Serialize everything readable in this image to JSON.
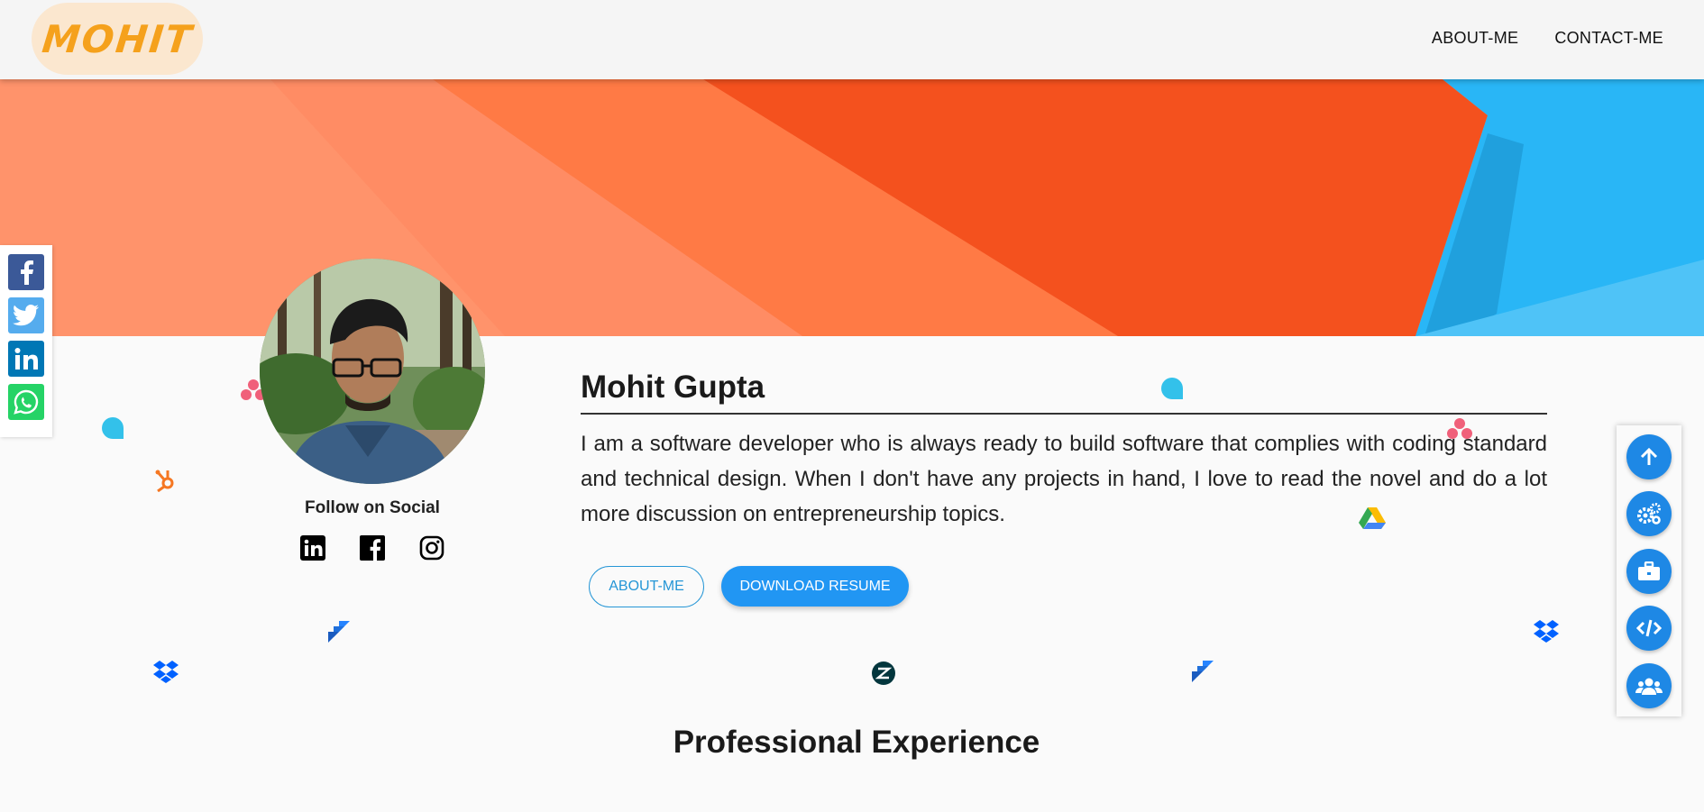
{
  "header": {
    "logo_text": "MOHIT",
    "nav": [
      {
        "label": "ABOUT-ME"
      },
      {
        "label": "CONTACT-ME"
      }
    ]
  },
  "sharebar": {
    "items": [
      {
        "icon": "facebook-icon",
        "color": "#3b5998"
      },
      {
        "icon": "twitter-icon",
        "color": "#55acee"
      },
      {
        "icon": "linkedin-icon",
        "color": "#0077b5"
      },
      {
        "icon": "whatsapp-icon",
        "color": "#25d366"
      }
    ]
  },
  "profile": {
    "follow_label": "Follow on Social",
    "social": [
      {
        "icon": "linkedin-icon"
      },
      {
        "icon": "facebook-icon"
      },
      {
        "icon": "instagram-icon"
      }
    ]
  },
  "intro": {
    "name": "Mohit Gupta",
    "bio": "I am a software developer who is always ready to build software that complies with coding standard and technical design. When I don't have any projects in hand, I love to read the novel and do a lot more discussion on entrepreneurship topics.",
    "about_button": "ABOUT-ME",
    "download_button": "DOWNLOAD RESUME"
  },
  "sections": {
    "experience_title": "Professional Experience"
  },
  "fab": [
    {
      "icon": "arrow-up-icon"
    },
    {
      "icon": "gears-icon"
    },
    {
      "icon": "briefcase-icon"
    },
    {
      "icon": "code-icon"
    },
    {
      "icon": "users-icon"
    }
  ],
  "colors": {
    "accent": "#2196f3",
    "banner_orange": "#f4511e",
    "banner_blue": "#29b6f6",
    "logo_bg": "#fbe7cf",
    "logo_text": "#f5a11c"
  }
}
